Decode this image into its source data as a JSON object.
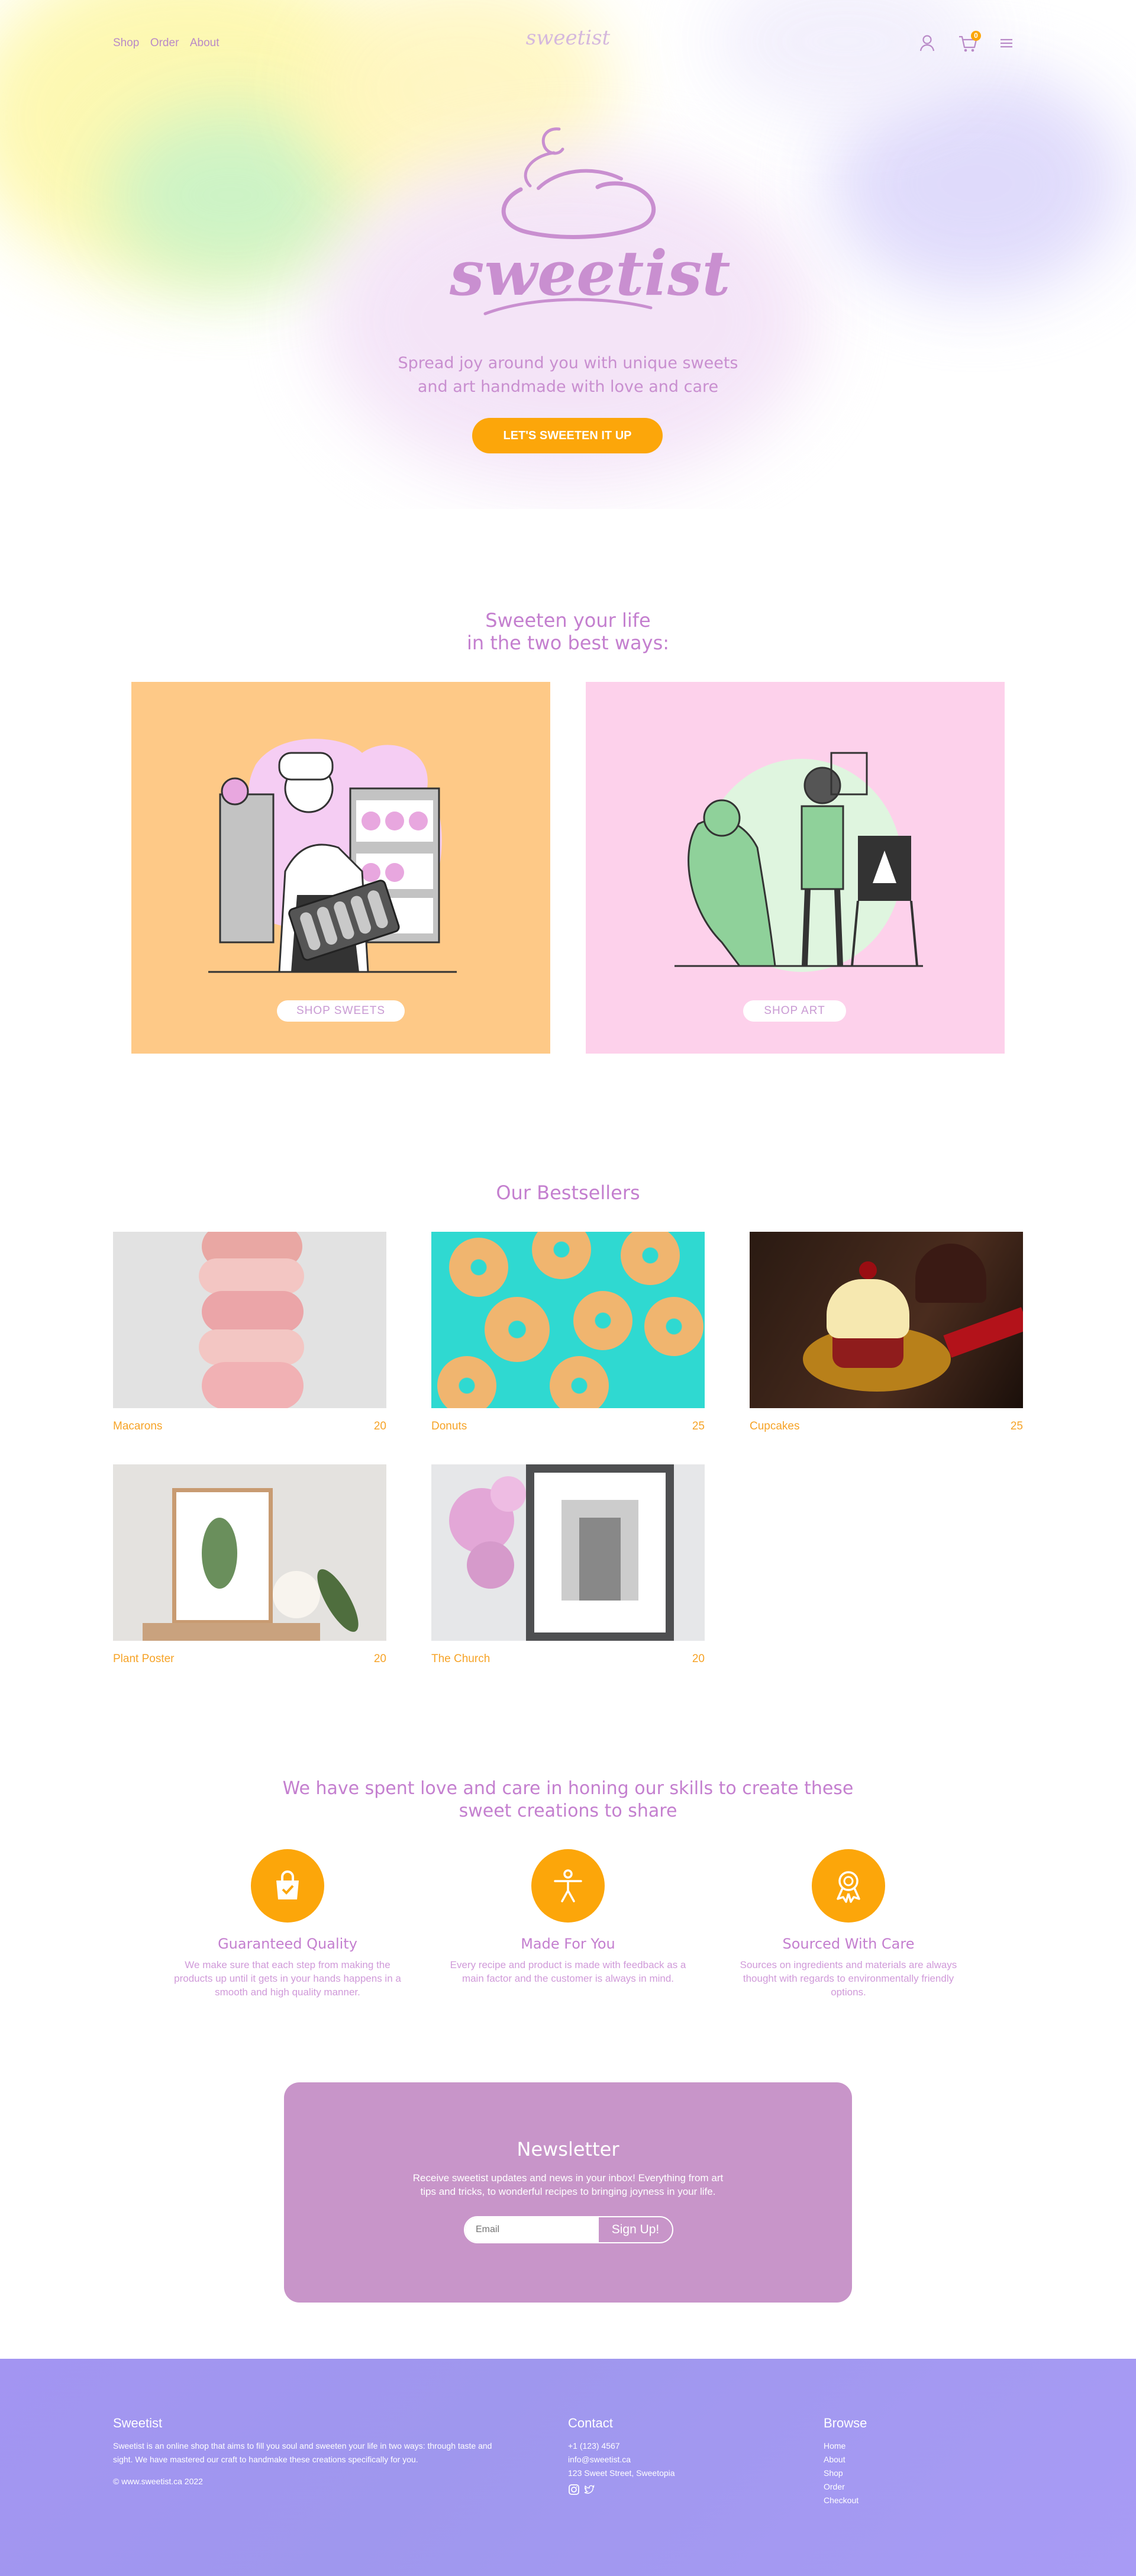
{
  "nav": {
    "links": [
      "Shop",
      "Order",
      "About"
    ],
    "logo_small": "sweetist",
    "cart_count": "0"
  },
  "hero": {
    "logo": "sweetist",
    "tagline_line1": "Spread joy around you with unique sweets",
    "tagline_line2": "and art handmade with love and care",
    "cta": "LET'S SWEETEN IT UP"
  },
  "ways": {
    "title_line1": "Sweeten your life",
    "title_line2": "in the two best ways:",
    "cards": [
      {
        "button": "SHOP SWEETS",
        "bg": "#fec987"
      },
      {
        "button": "SHOP ART",
        "bg": "#fdd1eb"
      }
    ]
  },
  "bestsellers": {
    "title": "Our Bestsellers",
    "items": [
      {
        "name": "Macarons",
        "price": "20"
      },
      {
        "name": "Donuts",
        "price": "25"
      },
      {
        "name": "Cupcakes",
        "price": "25"
      },
      {
        "name": "Plant Poster",
        "price": "20"
      },
      {
        "name": "The Church",
        "price": "20"
      }
    ]
  },
  "values": {
    "title_line1": "We have spent love and care in honing our skills to create these",
    "title_line2": "sweet creations to share",
    "items": [
      {
        "title": "Guaranteed Quality",
        "icon": "shopping-bag-check-icon",
        "text": "We make sure that each step from making the products up until it gets in your hands happens in a smooth and high quality manner."
      },
      {
        "title": "Made For You",
        "icon": "person-icon",
        "text": "Every recipe and product is made with feedback as a main factor and the customer is always in mind."
      },
      {
        "title": "Sourced With Care",
        "icon": "award-ribbon-icon",
        "text": "Sources on ingredients and materials are always thought with regards to environmentally friendly options."
      }
    ]
  },
  "newsletter": {
    "title": "Newsletter",
    "text_line1": "Receive sweetist updates and news in your inbox! Everything from art",
    "text_line2": "tips and tricks, to wonderful recipes to bringing joyness in your life.",
    "placeholder": "Email",
    "button": "Sign Up!"
  },
  "footer": {
    "about_title": "Sweetist",
    "about_text": "Sweetist is an online shop that aims to fill you soul and sweeten your life in two ways: through taste and sight. We have mastered our craft to handmake these creations specifically for you.",
    "copyright": "© www.sweetist.ca 2022",
    "contact_title": "Contact",
    "phone": "+1 (123) 4567",
    "email": "info@sweetist.ca",
    "address": "123 Sweet Street, Sweetopia",
    "browse_title": "Browse",
    "browse_links": [
      "Home",
      "About",
      "Shop",
      "Order",
      "Checkout"
    ]
  },
  "colors": {
    "accent_orange": "#fca60a",
    "accent_purple": "#c47fcf",
    "newsletter_bg": "#c895c9",
    "footer_bg": "#a296f2"
  }
}
